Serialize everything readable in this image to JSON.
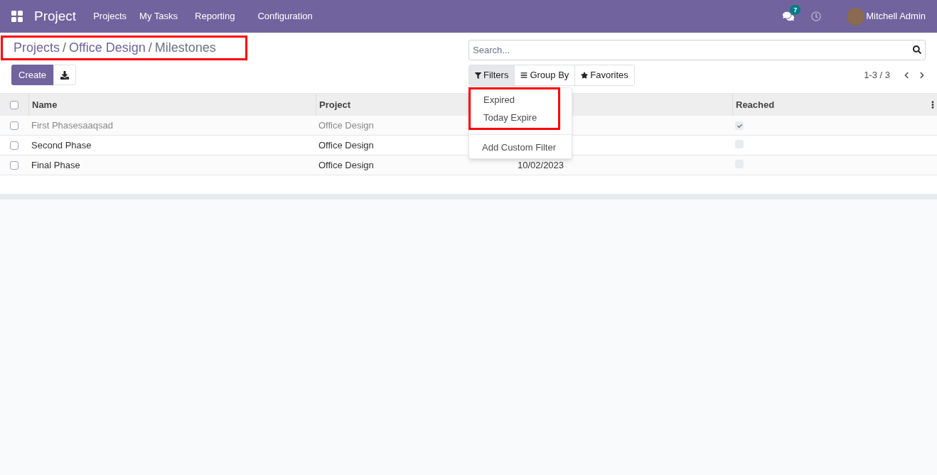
{
  "navbar": {
    "app": "Project",
    "menu": [
      "Projects",
      "My Tasks",
      "Reporting",
      "Configuration"
    ],
    "messages_badge": "7",
    "user": "Mitchell Admin"
  },
  "breadcrumb": {
    "highlighted": true,
    "separator": "/",
    "items": [
      "Projects",
      "Office Design",
      "Milestones"
    ]
  },
  "buttons": {
    "create": "Create"
  },
  "search": {
    "placeholder": "Search..."
  },
  "search_tabs": [
    {
      "label": "Filters",
      "kind": "filter",
      "selected": true
    },
    {
      "label": "Group By",
      "kind": "group",
      "selected": false
    },
    {
      "label": "Favorites",
      "kind": "favorite",
      "selected": false
    }
  ],
  "filters_menu": {
    "highlighted": true,
    "items": [
      "Expired",
      "Today Expire"
    ],
    "custom": "Add Custom Filter"
  },
  "pager": "1-3 / 3",
  "table": {
    "select_all": false,
    "columns": [
      {
        "label": "Name"
      },
      {
        "label": "Project"
      },
      {},
      {
        "label": "Reached"
      }
    ],
    "rows": [
      {
        "selected": false,
        "name": "First Phasesaaqsad",
        "project": "Office Design",
        "reached": true
      },
      {
        "selected": false,
        "name": "Second Phase",
        "project": "Office Design",
        "reached": false
      },
      {
        "selected": false,
        "name": "Final Phase",
        "project": "Office Design",
        "column_3": "10/02/2023",
        "reached": false
      }
    ]
  }
}
